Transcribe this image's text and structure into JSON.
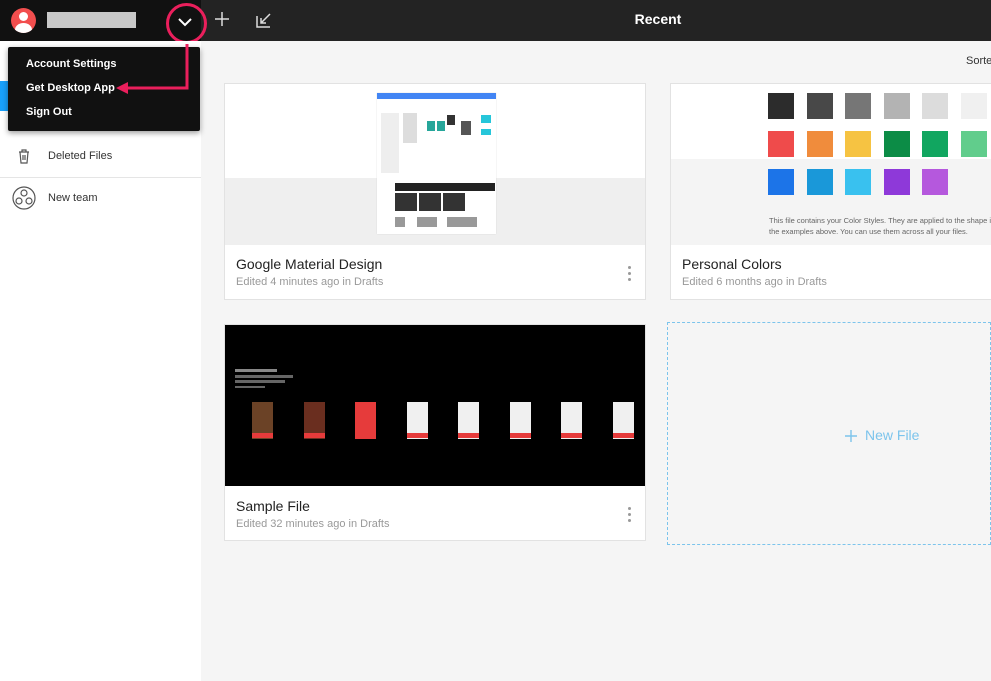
{
  "header": {
    "title": "Recent"
  },
  "account_menu": {
    "items": [
      "Account Settings",
      "Get Desktop App",
      "Sign Out"
    ]
  },
  "sidebar": {
    "items": [
      {
        "label": "Deleted Files",
        "icon": "trash-icon"
      },
      {
        "label": "New team",
        "icon": "team-icon"
      }
    ]
  },
  "main": {
    "sort_label": "Sorte",
    "files": [
      {
        "title": "Google Material Design",
        "subtitle": "Edited 4 minutes ago in Drafts"
      },
      {
        "title": "Personal Colors",
        "subtitle": "Edited 6 months ago in Drafts",
        "thumb_text": "This file contains your Color Styles. They are applied to the shape in the examples above. You can use them across all your files."
      },
      {
        "title": "Sample File",
        "subtitle": "Edited 32 minutes ago in Drafts"
      }
    ],
    "new_file_label": "New File"
  },
  "colors": {
    "accent": "#18a0fb",
    "highlight": "#ea1f5c",
    "swatches": [
      "#2c2c2c",
      "#484848",
      "#767676",
      "#b3b3b3",
      "#dcdcdc",
      "#f0f0f0",
      "#ef4b4b",
      "#f08c3c",
      "#f6c342",
      "#0c8c46",
      "#11a660",
      "#61cd8c",
      "#1c74e8",
      "#1a98d9",
      "#39c1ef",
      "#8e39d9",
      "#b558dd"
    ]
  }
}
